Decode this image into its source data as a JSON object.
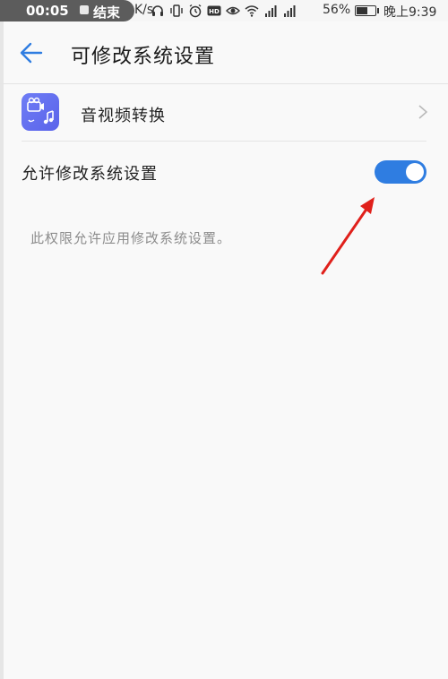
{
  "status_bar": {
    "recording_time": "00:05",
    "recording_end": "结束",
    "speed_unit_tail": "K/s",
    "battery_percent": "56%",
    "time": "晚上9:39",
    "icons": [
      "headset-icon",
      "vibrate-icon",
      "alarm-icon",
      "hd-icon",
      "eye-icon",
      "wifi-icon",
      "signal-icon",
      "signal-icon",
      "battery-icon"
    ]
  },
  "toolbar": {
    "title": "可修改系统设置",
    "back_icon": "arrow-left-icon"
  },
  "app_row": {
    "app_name": "音视频转换",
    "chevron_icon": "chevron-right-icon"
  },
  "permission": {
    "toggle_label": "允许修改系统设置",
    "toggle_state": "on",
    "description": "此权限允许应用修改系统设置。"
  },
  "colors": {
    "accent": "#2f7de1",
    "app_icon_bg": "#6f7df5",
    "annotation_arrow": "#e0201b"
  }
}
